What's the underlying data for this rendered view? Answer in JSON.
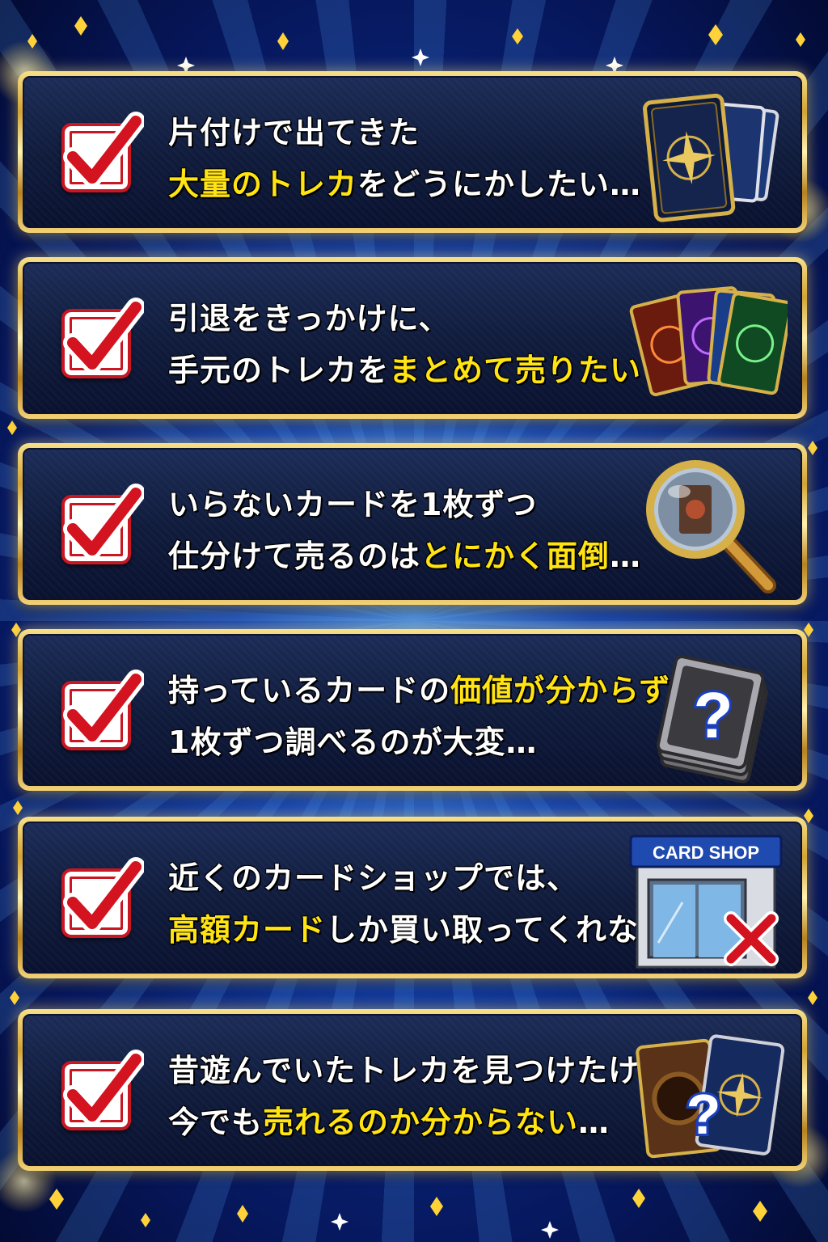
{
  "colors": {
    "accent_yellow": "#ffe313",
    "text_white": "#ffffff",
    "check_red": "#c81622",
    "gold": "#d4a334",
    "panel_navy": "#101b3b"
  },
  "items": [
    {
      "line1": [
        {
          "t": "片付けで出てきた",
          "h": false
        }
      ],
      "line2": [
        {
          "t": "大量のトレカ",
          "h": true
        },
        {
          "t": "をどうにかしたい…",
          "h": false
        }
      ],
      "icon": "card-stack-icon"
    },
    {
      "line1": [
        {
          "t": "引退をきっかけに、",
          "h": false
        }
      ],
      "line2": [
        {
          "t": "手元のトレカを",
          "h": false
        },
        {
          "t": "まとめて売りたい",
          "h": true
        }
      ],
      "icon": "card-fan-icon"
    },
    {
      "line1": [
        {
          "t": "いらないカードを1枚ずつ",
          "h": false
        }
      ],
      "line2": [
        {
          "t": "仕分けて売るのは",
          "h": false
        },
        {
          "t": "とにかく面倒",
          "h": true
        },
        {
          "t": "…",
          "h": false
        }
      ],
      "icon": "magnifier-icon"
    },
    {
      "line1": [
        {
          "t": "持っているカードの",
          "h": false
        },
        {
          "t": "価値が分からず",
          "h": true
        },
        {
          "t": "、",
          "h": false
        }
      ],
      "line2": [
        {
          "t": "1枚ずつ調べるのが大変…",
          "h": false
        }
      ],
      "icon": "question-card-icon"
    },
    {
      "line1": [
        {
          "t": "近くのカードショップでは、",
          "h": false
        }
      ],
      "line2": [
        {
          "t": "高額カード",
          "h": true
        },
        {
          "t": "しか買い取ってくれない…",
          "h": false
        }
      ],
      "icon": "card-shop-icon",
      "shop_sign": "CARD SHOP"
    },
    {
      "line1": [
        {
          "t": "昔遊んでいたトレカを見つけたけど、",
          "h": false
        }
      ],
      "line2": [
        {
          "t": "今でも",
          "h": false
        },
        {
          "t": "売れるのか分からない",
          "h": true
        },
        {
          "t": "…",
          "h": false
        }
      ],
      "icon": "old-cards-question-icon"
    }
  ]
}
